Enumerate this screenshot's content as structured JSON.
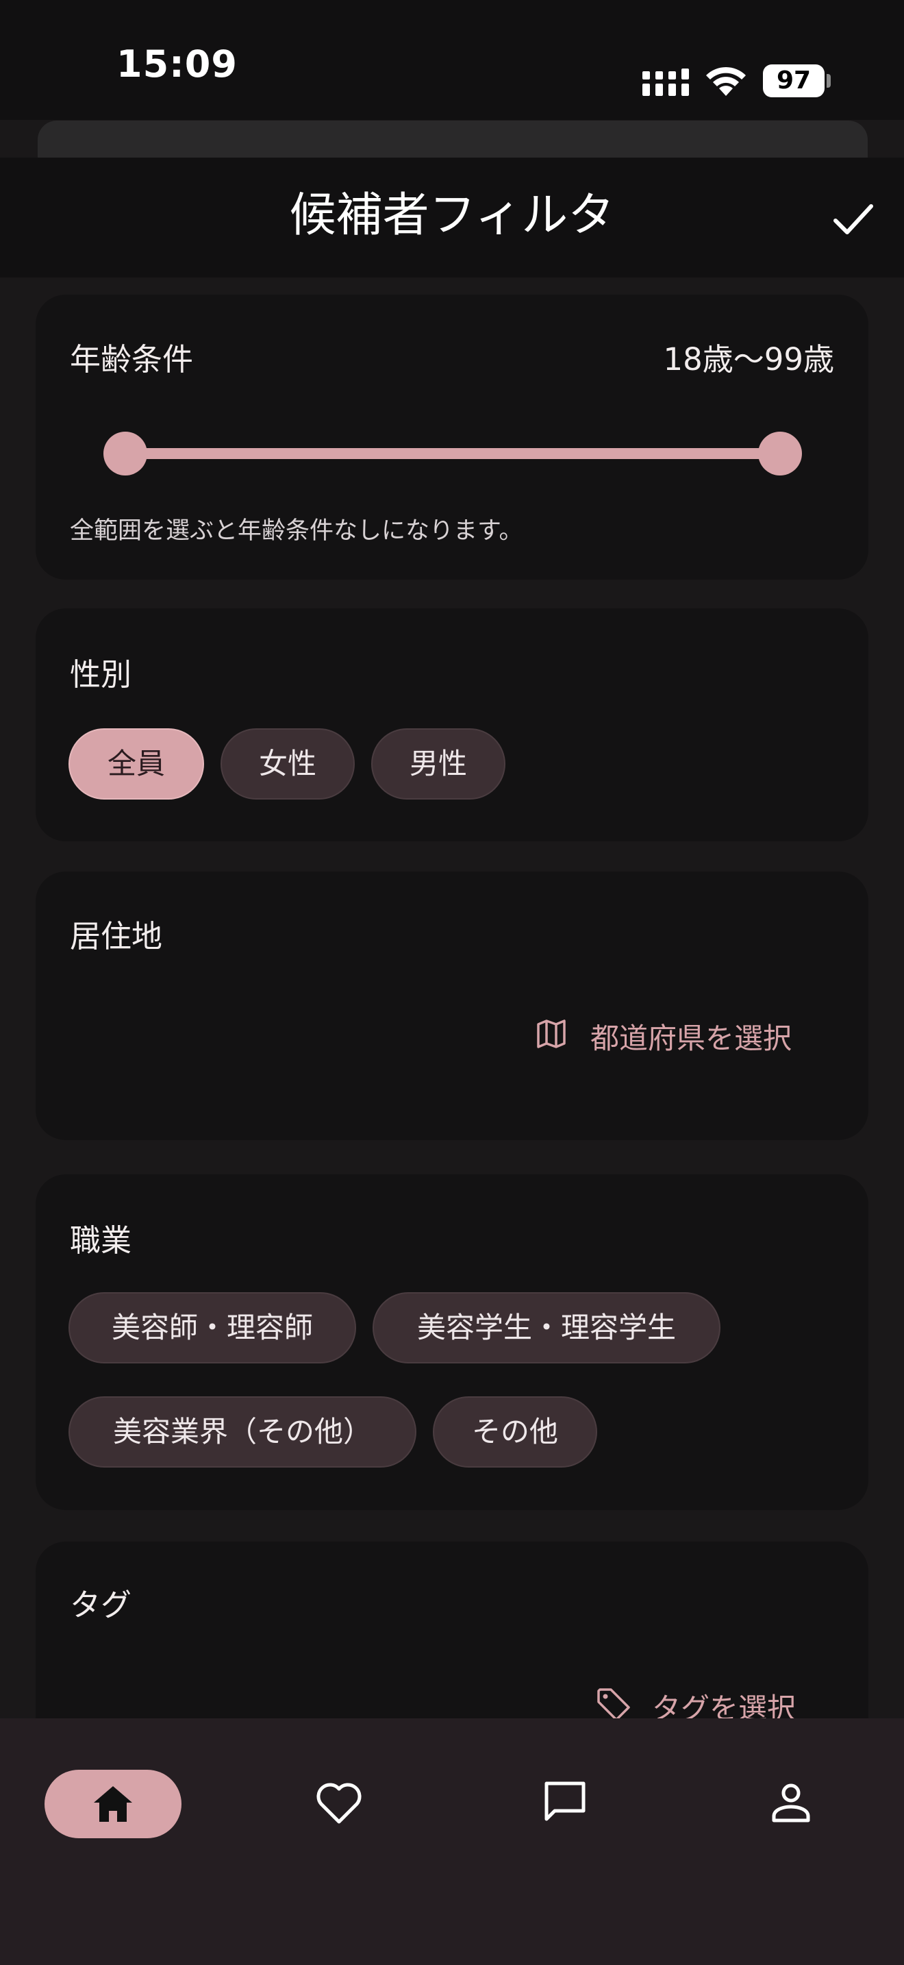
{
  "status_bar": {
    "time": "15:09",
    "battery": "97"
  },
  "header": {
    "title": "候補者フィルタ"
  },
  "age": {
    "title": "年齢条件",
    "value": "18歳〜99歳",
    "hint": "全範囲を選ぶと年齢条件なしになります。",
    "range": {
      "min": 18,
      "max": 99,
      "selected_min": 18,
      "selected_max": 99
    }
  },
  "gender": {
    "title": "性別",
    "options": [
      {
        "label": "全員",
        "selected": true
      },
      {
        "label": "女性",
        "selected": false
      },
      {
        "label": "男性",
        "selected": false
      }
    ]
  },
  "residence": {
    "title": "居住地",
    "action": "都道府県を選択"
  },
  "occupation": {
    "title": "職業",
    "options": [
      {
        "label": "美容師・理容師"
      },
      {
        "label": "美容学生・理容学生"
      },
      {
        "label": "美容業界（その他）"
      },
      {
        "label": "その他"
      }
    ]
  },
  "tags": {
    "title": "タグ",
    "action": "タグを選択"
  },
  "colors": {
    "accent": "#d7a4a9",
    "chip": "#3c2f33",
    "card": "#131213",
    "nav": "#251e22"
  },
  "bottom_nav": [
    {
      "icon": "home-icon",
      "active": true
    },
    {
      "icon": "heart-icon",
      "active": false
    },
    {
      "icon": "chat-icon",
      "active": false
    },
    {
      "icon": "person-icon",
      "active": false
    }
  ]
}
